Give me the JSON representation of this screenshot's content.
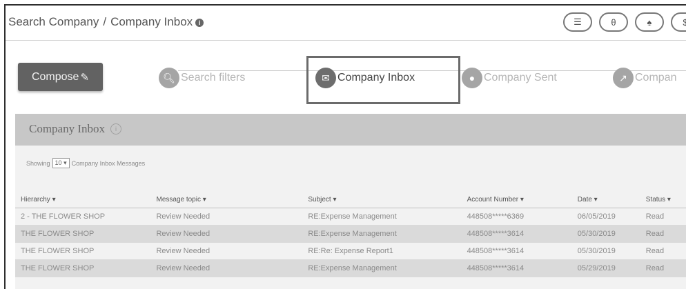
{
  "breadcrumb": {
    "root": "Search Company",
    "separator": "/",
    "current": "Company Inbox",
    "info_glyph": "i"
  },
  "top_icons": [
    {
      "name": "list-icon",
      "glyph": "☰"
    },
    {
      "name": "user-icon",
      "glyph": "θ"
    },
    {
      "name": "bell-icon",
      "glyph": "♠"
    },
    {
      "name": "dollar-icon",
      "glyph": "$"
    }
  ],
  "compose": {
    "label": "Compose",
    "icon": "edit-icon",
    "glyph": "✎"
  },
  "steps": [
    {
      "label": "Search filters",
      "icon": "search-icon",
      "glyph": "🔍︎"
    },
    {
      "label": "Company Inbox",
      "icon": "envelope-icon",
      "glyph": "✉"
    },
    {
      "label": "Company Sent",
      "icon": "person-icon",
      "glyph": "●"
    },
    {
      "label": "Compan",
      "icon": "share-icon",
      "glyph": "↗"
    }
  ],
  "panel": {
    "title": "Company Inbox",
    "showing_prefix": "Showing",
    "page_size": "10",
    "page_size_caret": "▾",
    "showing_suffix": "Company Inbox Messages"
  },
  "table": {
    "columns": [
      "Hierarchy ▾",
      "Message topic ▾",
      "Subject ▾",
      "Account Number ▾",
      "Date ▾",
      "Status ▾"
    ],
    "rows": [
      [
        "2 - THE FLOWER SHOP",
        "Review Needed",
        "RE:Expense Management",
        "448508*****6369",
        "06/05/2019",
        "Read"
      ],
      [
        "THE FLOWER SHOP",
        "Review Needed",
        "RE:Expense Management",
        "448508*****3614",
        "05/30/2019",
        "Read"
      ],
      [
        "THE FLOWER SHOP",
        "Review Needed",
        "RE:Re: Expense Report1",
        "448508*****3614",
        "05/30/2019",
        "Read"
      ],
      [
        "THE FLOWER SHOP",
        "Review Needed",
        "RE:Expense Management",
        "448508*****3614",
        "05/29/2019",
        "Read"
      ]
    ]
  }
}
